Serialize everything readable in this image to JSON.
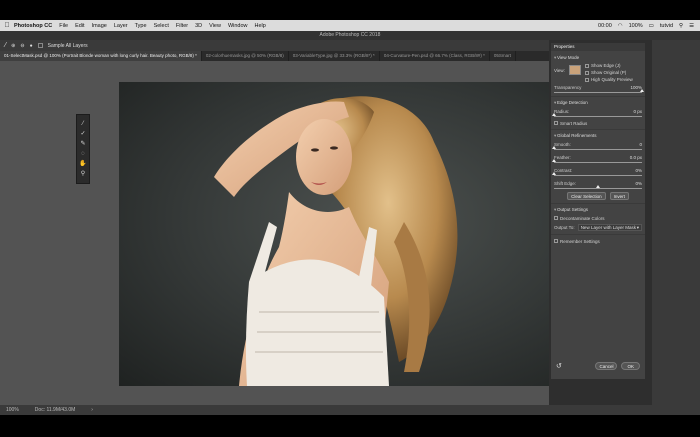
{
  "menubar": {
    "app_name": "Photoshop CC",
    "items": [
      "File",
      "Edit",
      "Image",
      "Layer",
      "Type",
      "Select",
      "Filter",
      "3D",
      "View",
      "Window",
      "Help"
    ],
    "time": "00:00",
    "battery": "100%",
    "user": "tutvid"
  },
  "window_title": "Adobe Photoshop CC 2018",
  "options_bar": {
    "sample_all_layers": "Sample All Layers"
  },
  "tabs": [
    {
      "label": "01-SelectMask.psd @ 100% (Portrait  Blonde woman with long curly hair. Beauty photo, RGB/8) *",
      "active": true
    },
    {
      "label": "02-colorhuemasks.jpg @ 50% (RGB/8)",
      "active": false
    },
    {
      "label": "03-VariableType.jpg @ 33.3% (RGB/8*) *",
      "active": false
    },
    {
      "label": "04-Curvature-Pen.psd @ 66.7% (Class, RGB/8#) *",
      "active": false
    },
    {
      "label": "05Smart",
      "active": false
    }
  ],
  "tools": [
    {
      "icon": "quick-selection-icon",
      "glyph": "⁄"
    },
    {
      "icon": "refine-edge-brush-icon",
      "glyph": "✓"
    },
    {
      "icon": "brush-icon",
      "glyph": "✎"
    },
    {
      "icon": "lasso-icon",
      "glyph": "◌"
    },
    {
      "icon": "hand-icon",
      "glyph": "✋"
    },
    {
      "icon": "zoom-icon",
      "glyph": "⚲"
    }
  ],
  "properties": {
    "title": "Properties",
    "view_mode": {
      "heading": "View Mode",
      "view_label": "View:",
      "show_edge": "Show Edge (J)",
      "show_original": "Show Original (P)",
      "high_quality": "High Quality Preview",
      "transparency_label": "Transparency",
      "transparency_value": "100%",
      "transparency_level": 1.0
    },
    "edge_detection": {
      "heading": "Edge Detection",
      "radius_label": "Radius:",
      "radius_value": "0 px",
      "radius_level": 0,
      "smart_radius": "Smart Radius"
    },
    "global_refinements": {
      "heading": "Global Refinements",
      "smooth_label": "Smooth:",
      "smooth_value": "0",
      "smooth_level": 0,
      "feather_label": "Feather:",
      "feather_value": "0.0 px",
      "feather_level": 0,
      "contrast_label": "Contrast:",
      "contrast_value": "0%",
      "contrast_level": 0,
      "shift_edge_label": "Shift Edge:",
      "shift_edge_value": "0%",
      "shift_edge_level": 0.5,
      "clear_selection": "Clear Selection",
      "invert": "Invert"
    },
    "output_settings": {
      "heading": "Output Settings",
      "decontaminate": "Decontaminate Colors",
      "output_to_label": "Output To:",
      "output_to_value": "New Layer with Layer Mask",
      "remember": "Remember Settings"
    },
    "cancel": "Cancel",
    "ok": "OK"
  },
  "status": {
    "zoom": "100%",
    "doc": "Doc: 11.9M/43.0M"
  }
}
